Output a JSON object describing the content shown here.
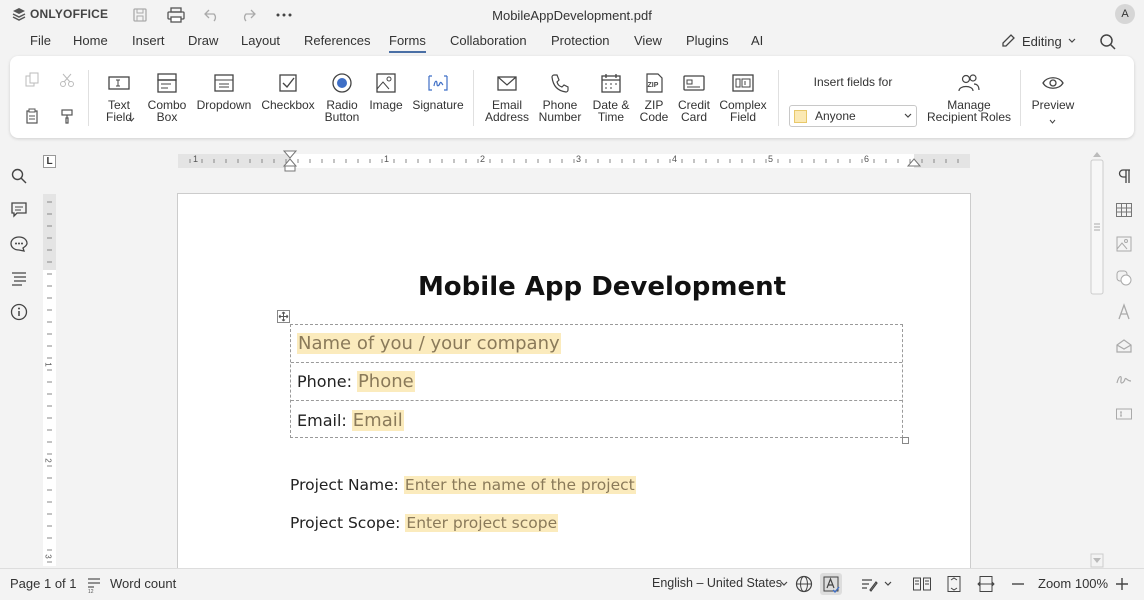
{
  "app": {
    "brand": "ONLYOFFICE",
    "doc_title": "MobileAppDevelopment.pdf",
    "avatar_initial": "A"
  },
  "menu": {
    "tabs": [
      "File",
      "Home",
      "Insert",
      "Draw",
      "Layout",
      "References",
      "Forms",
      "Collaboration",
      "Protection",
      "View",
      "Plugins",
      "AI"
    ],
    "active": "Forms",
    "mode": "Editing"
  },
  "ribbon": {
    "text_field": "Text\nField",
    "combo_box": "Combo\nBox",
    "dropdown": "Dropdown",
    "checkbox": "Checkbox",
    "radio_button": "Radio\nButton",
    "image": "Image",
    "signature": "Signature",
    "email_address": "Email\nAddress",
    "phone_number": "Phone\nNumber",
    "date_time": "Date &\nTime",
    "zip_code": "ZIP\nCode",
    "credit_card": "Credit\nCard",
    "complex_field": "Complex\nField",
    "insert_fields_for": "Insert fields for",
    "recipient": "Anyone",
    "manage_roles": "Manage\nRecipient Roles",
    "preview": "Preview"
  },
  "ruler": {
    "h_numbers": [
      "1",
      "1",
      "2",
      "3",
      "4",
      "5",
      "6"
    ],
    "v_numbers": [
      "1",
      "2",
      "3"
    ]
  },
  "document": {
    "heading": "Mobile App Development",
    "name_placeholder": "Name of you / your company",
    "phone_label": "Phone:",
    "phone_placeholder": "Phone",
    "email_label": "Email:",
    "email_placeholder": "Email",
    "project_name_label": "Project Name:",
    "project_name_placeholder": "Enter the name of the project",
    "project_scope_label": "Project Scope:",
    "project_scope_placeholder": "Enter project scope"
  },
  "status": {
    "page": "Page 1 of 1",
    "word_count": "Word count",
    "language": "English – United States",
    "zoom": "Zoom 100%"
  },
  "colors": {
    "accent": "#4a6fa5",
    "form_field_fill": "#fbebbd"
  }
}
